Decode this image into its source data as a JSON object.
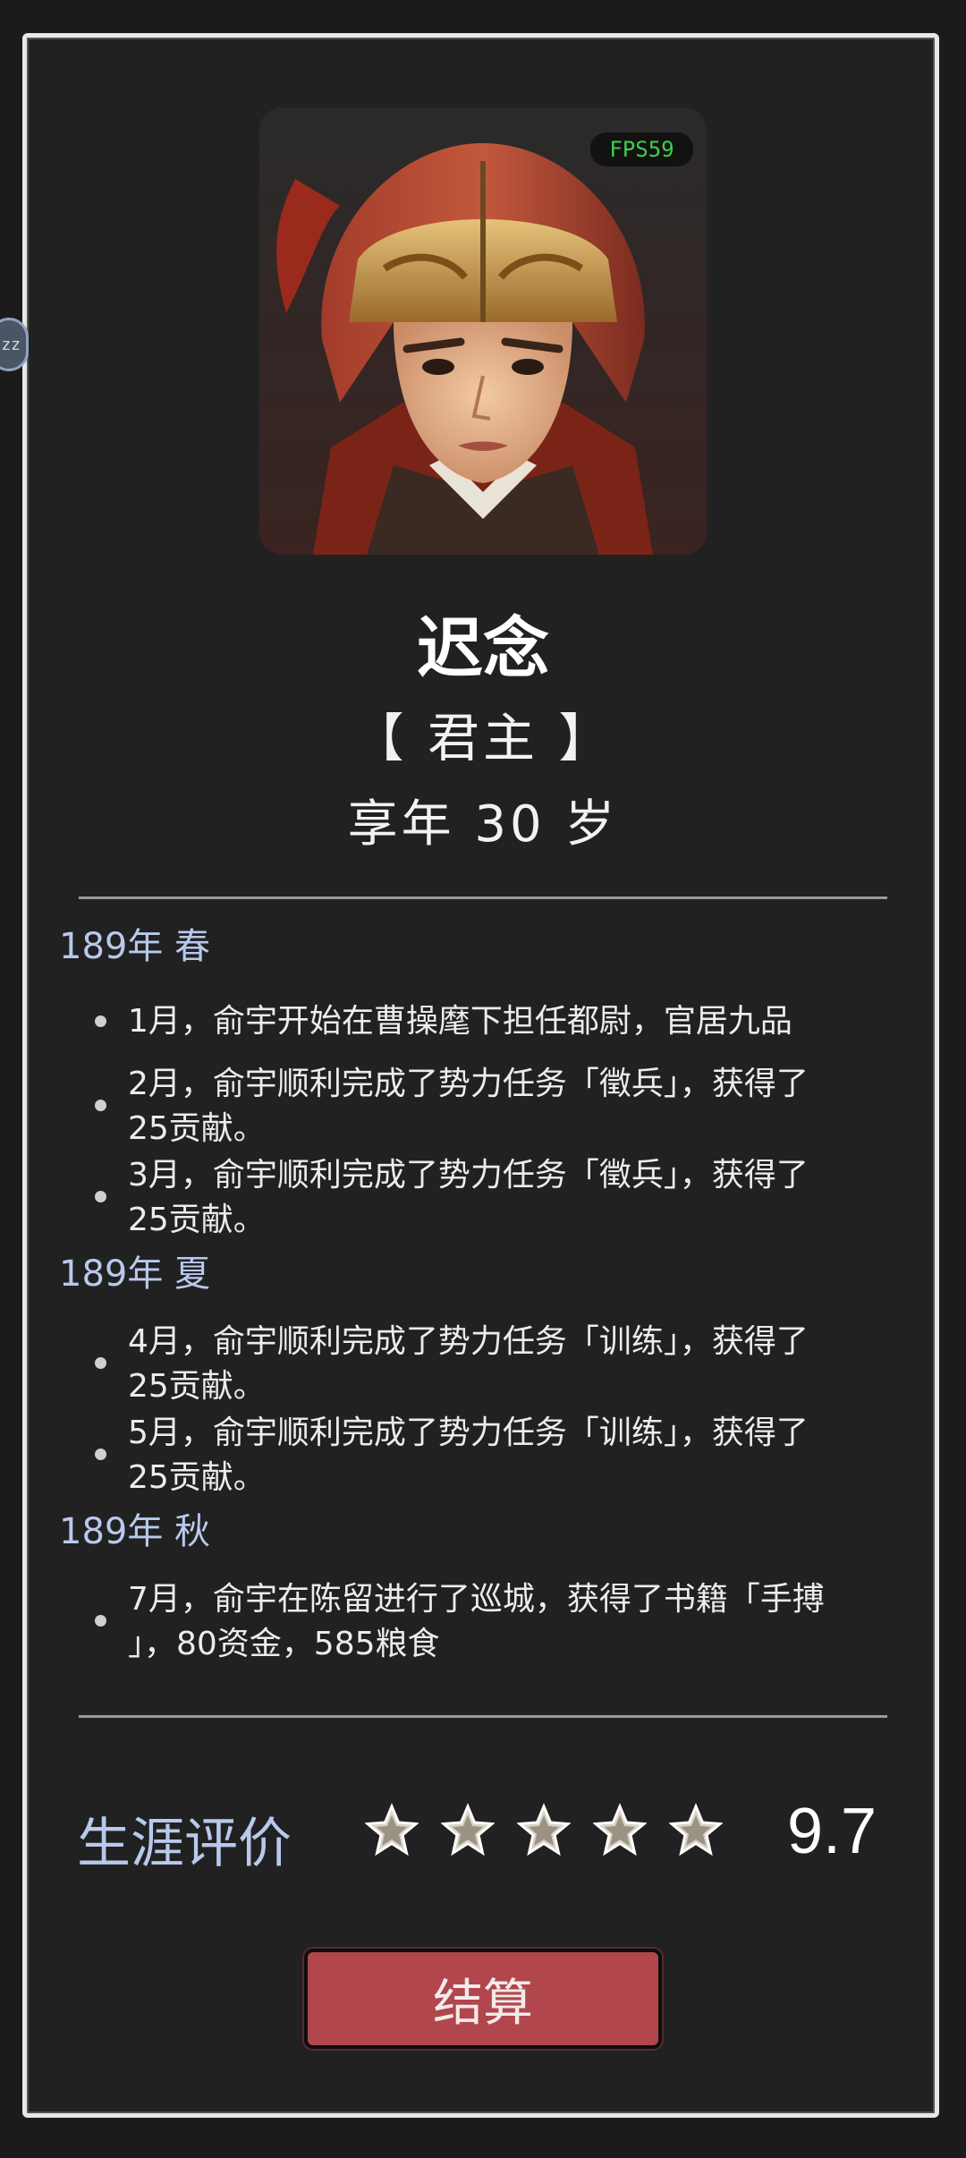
{
  "fps_label": "FPS59",
  "side_tab_label": "zz",
  "character": {
    "name": "迟念",
    "title": "【 君主 】",
    "age_text": "享年 30 岁"
  },
  "timeline": [
    {
      "season": "189年 春",
      "entries": [
        {
          "line1": "1月，俞宇开始在曹操麾下担任都尉，官居九品",
          "line2": ""
        },
        {
          "line1": "2月，俞宇顺利完成了势力任务「徵兵」，获得了",
          "line2": "25贡献。"
        },
        {
          "line1": "3月，俞宇顺利完成了势力任务「徵兵」，获得了",
          "line2": "25贡献。"
        }
      ]
    },
    {
      "season": "189年 夏",
      "entries": [
        {
          "line1": "4月，俞宇顺利完成了势力任务「训练」，获得了",
          "line2": "25贡献。"
        },
        {
          "line1": "5月，俞宇顺利完成了势力任务「训练」，获得了",
          "line2": "25贡献。"
        }
      ]
    },
    {
      "season": "189年 秋",
      "entries": [
        {
          "line1": "7月，俞宇在陈留进行了巡城，获得了书籍「手搏",
          "line2": "」，80资金，585粮食"
        }
      ]
    }
  ],
  "rating": {
    "label": "生涯评价",
    "stars_filled": 5,
    "stars_total": 5,
    "score": "9.7"
  },
  "settle_button_label": "结算",
  "colors": {
    "panel_bg": "#212121",
    "accent_blue": "#b9c9ec",
    "button_red": "#b1474c",
    "fps_green": "#3fcf4a"
  }
}
